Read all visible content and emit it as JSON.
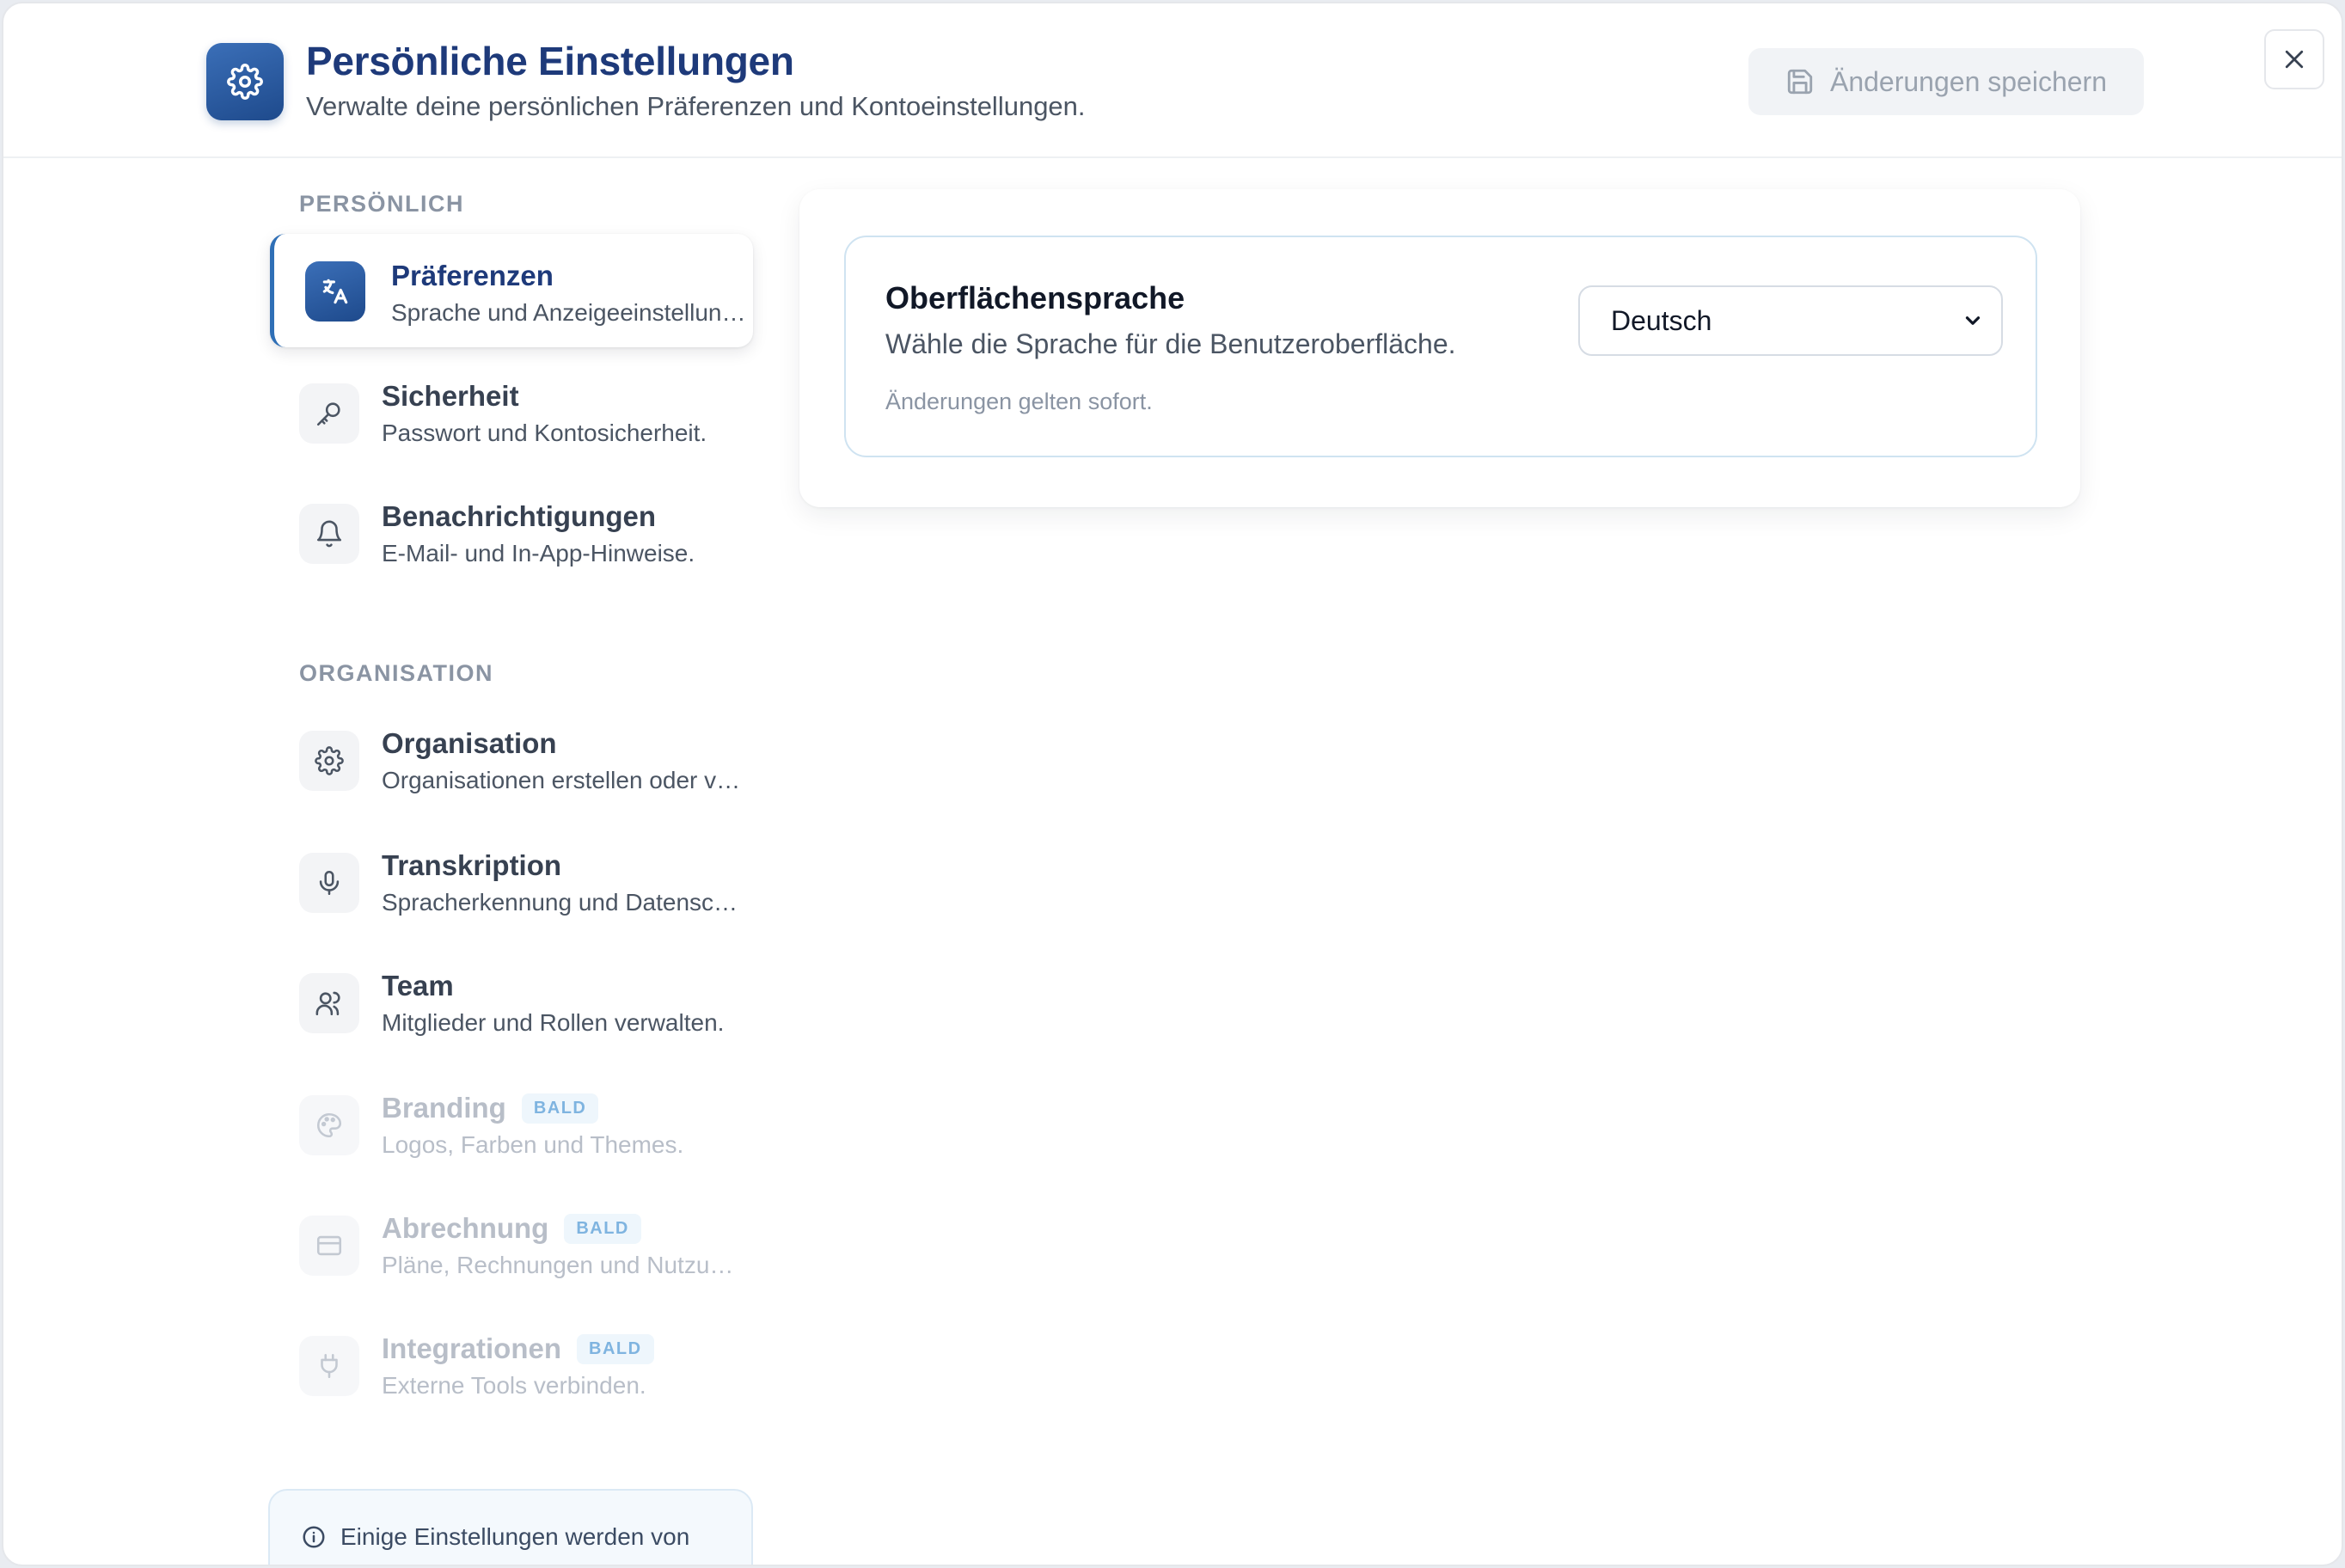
{
  "header": {
    "title": "Persönliche Einstellungen",
    "subtitle": "Verwalte deine persönlichen Präferenzen und Kontoeinstellungen.",
    "save_label": "Änderungen speichern"
  },
  "sidebar": {
    "sections": [
      {
        "label": "PERSÖNLICH",
        "items": [
          {
            "title": "Präferenzen",
            "subtitle": "Sprache und Anzeigeeinstellungen.",
            "icon": "translate-icon",
            "active": true
          },
          {
            "title": "Sicherheit",
            "subtitle": "Passwort und Kontosicherheit.",
            "icon": "key-icon"
          },
          {
            "title": "Benachrichtigungen",
            "subtitle": "E-Mail- und In-App-Hinweise.",
            "icon": "bell-icon"
          }
        ]
      },
      {
        "label": "ORGANISATION",
        "items": [
          {
            "title": "Organisation",
            "subtitle": "Organisationen erstellen oder verwalten.",
            "icon": "gear-icon"
          },
          {
            "title": "Transkription",
            "subtitle": "Spracherkennung und Datenschutz.",
            "icon": "microphone-icon"
          },
          {
            "title": "Team",
            "subtitle": "Mitglieder und Rollen verwalten.",
            "icon": "users-icon"
          },
          {
            "title": "Branding",
            "subtitle": "Logos, Farben und Themes.",
            "icon": "palette-icon",
            "badge": "BALD",
            "disabled": true
          },
          {
            "title": "Abrechnung",
            "subtitle": "Pläne, Rechnungen und Nutzung.",
            "icon": "credit-card-icon",
            "badge": "BALD",
            "disabled": true
          },
          {
            "title": "Integrationen",
            "subtitle": "Externe Tools verbinden.",
            "icon": "plug-icon",
            "badge": "BALD",
            "disabled": true
          }
        ]
      }
    ],
    "info_text": "Einige Einstellungen werden von"
  },
  "main": {
    "setting": {
      "title": "Oberflächensprache",
      "description": "Wähle die Sprache für die Benutzeroberfläche.",
      "hint": "Änderungen gelten sofort.",
      "selected_language": "Deutsch"
    }
  },
  "colors": {
    "accent": "#1e3a7a",
    "brand_gradient_start": "#3b6fb8",
    "brand_gradient_end": "#1e4a8c",
    "badge_text": "#7fb4e0"
  }
}
